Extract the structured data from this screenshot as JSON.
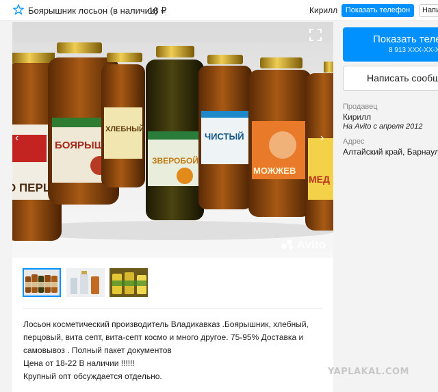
{
  "header": {
    "title": "Боярышник лосьон (в наличии)",
    "price": "18 ₽",
    "seller": "Кирилл",
    "show_phone": "Показать телефон",
    "write": "Написать"
  },
  "gallery": {
    "watermark": "Avito",
    "bottle_labels": [
      "О ПЕРЦА",
      "БОЯРЫШНИК",
      "ХЛЕБНЫЙ",
      "ЗВЕРОБОЙ",
      "ЧИСТЫЙ",
      "МОЖЖЕВ",
      "МЕД"
    ],
    "thumbnails": [
      "thumb-1",
      "thumb-2",
      "thumb-3"
    ]
  },
  "description": {
    "line1": "Лосьон косметический производитель Владикавказ .Боярышник, хлебный,",
    "line2": "перцовый, вита септ, вита-септ космо и много другое. 75-95% Доставка и",
    "line3": "самовывоз . Полный пакет документов",
    "line4": "Цена от 18-22 В наличии !!!!!!",
    "line5": "Крупный опт обсуждается отдельно."
  },
  "sidebar": {
    "phone_button": "Показать теле",
    "phone_masked": "8 913 XXX-XX-X",
    "write_button": "Написать сообщ",
    "seller_label": "Продавец",
    "seller_name": "Кирилл",
    "seller_since": "На Avito с апреля 2012",
    "address_label": "Адрес",
    "address_value": "Алтайский край, Барнаул"
  },
  "watermark_site": "YAPLAKAL.COM",
  "colors": {
    "accent": "#0091ff",
    "text": "#222222",
    "muted": "#888888"
  }
}
